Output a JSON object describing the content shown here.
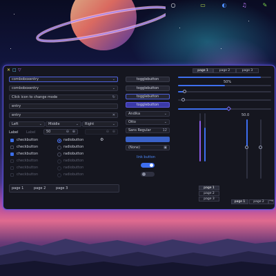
{
  "colors": {
    "accent": "#3e6ff0",
    "window_border": "#5b4fd6",
    "window_bg": "#15161f"
  },
  "topbar": {
    "icons": [
      {
        "name": "power-icon",
        "glyph": "○",
        "color": "#ffffff"
      },
      {
        "name": "files-icon",
        "glyph": "▭",
        "color": "#b8d848"
      },
      {
        "name": "browser-icon",
        "glyph": "◐",
        "color": "#4d8cff"
      },
      {
        "name": "music-icon",
        "glyph": "♫",
        "color": "#c07cff"
      },
      {
        "name": "edit-icon",
        "glyph": "✎",
        "color": "#7dd64a"
      }
    ]
  },
  "titlebar": {
    "close": "✕",
    "maximize": "□",
    "minimize": "▽"
  },
  "left": {
    "combo1": "comboboxentry",
    "combo2": "comboboxentry",
    "mode_entry": "Click icon to change mode",
    "entry1": "entry",
    "entry2": "entry",
    "align": [
      "Left",
      "Middle",
      "Right"
    ],
    "label1": "Label",
    "label2": "Label",
    "spin_value": "50",
    "checkbuttons": [
      "checkbutton",
      "checkbutton",
      "checkbutton",
      "checkbutton",
      "checkbutton",
      "checkbutton"
    ],
    "radiobuttons": [
      "radiobutton",
      "radiobutton",
      "radiobutton",
      "radiobutton",
      "radiobutton",
      "radiobutton"
    ],
    "tabs": [
      "page 1",
      "page 2",
      "page 3"
    ]
  },
  "middle": {
    "toggles": [
      "togglebutton",
      "togglebutton",
      "togglebutton",
      "togglebutton"
    ],
    "combo_font1": "Andika",
    "combo_font2": "Otto",
    "font_button": "Sans Regular",
    "font_size": "12",
    "file_button": "(None)",
    "link": "link button",
    "switch_on": true,
    "switch2_on": false
  },
  "right": {
    "tabs_top": [
      "page 1",
      "page 2",
      "page 3"
    ],
    "progress_label": "50%",
    "progress": 0.5,
    "scale_label": "50.0",
    "tabs_side": [
      "page 1",
      "page 2",
      "page 3"
    ],
    "tabs_bottom": [
      "page 1",
      "page 2",
      "page 3"
    ]
  }
}
